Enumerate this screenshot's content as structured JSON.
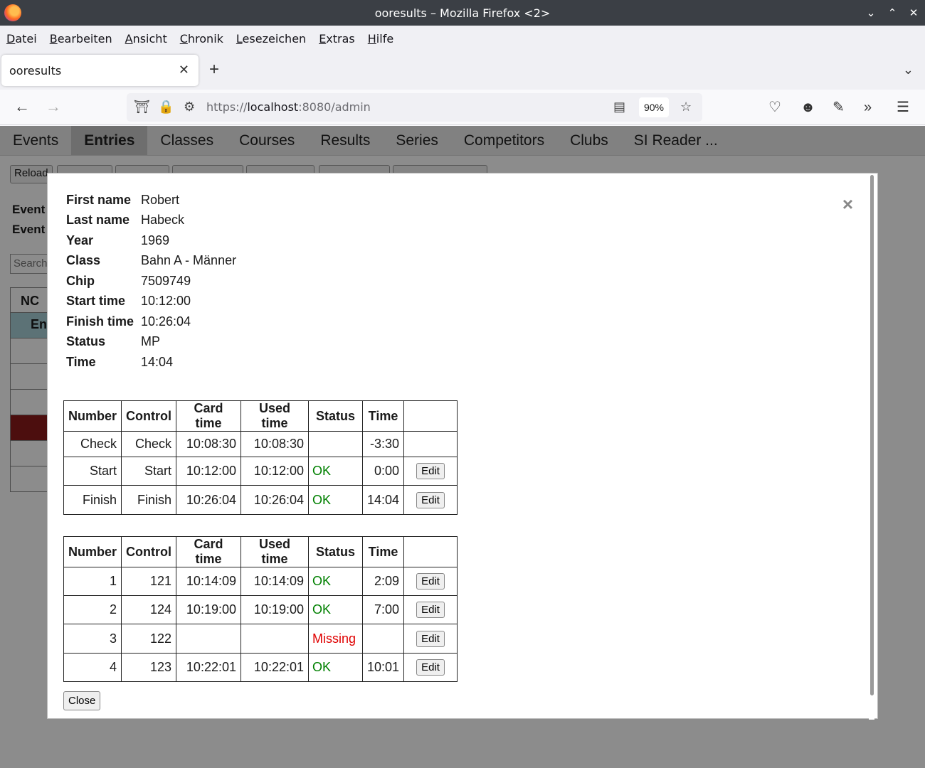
{
  "window": {
    "title": "ooresults – Mozilla Firefox <2>",
    "controls": [
      "⌄",
      "⌃",
      "✕"
    ]
  },
  "menubar": [
    "Datei",
    "Bearbeiten",
    "Ansicht",
    "Chronik",
    "Lesezeichen",
    "Extras",
    "Hilfe"
  ],
  "tab": {
    "label": "ooresults",
    "close": "✕",
    "new": "+",
    "list": "⌄"
  },
  "nav": {
    "url_prefix": "https://",
    "url_host": "localhost",
    "url_rest": ":8080/admin",
    "zoom": "90%"
  },
  "app_nav": {
    "items": [
      "Events",
      "Entries",
      "Classes",
      "Courses",
      "Results",
      "Series",
      "Competitors",
      "Clubs",
      "SI Reader ..."
    ],
    "active": "Entries"
  },
  "background": {
    "toolbar_first": "Reload",
    "event_label_1": "Event",
    "event_label_2": "Event",
    "search_placeholder": "Search",
    "table_header": "NC",
    "table_group": "Ent"
  },
  "details": [
    {
      "label": "First name",
      "value": "Robert"
    },
    {
      "label": "Last name",
      "value": "Habeck"
    },
    {
      "label": "Year",
      "value": "1969"
    },
    {
      "label": "Class",
      "value": "Bahn A - Männer"
    },
    {
      "label": "Chip",
      "value": "7509749"
    },
    {
      "label": "Start time",
      "value": "10:12:00"
    },
    {
      "label": "Finish time",
      "value": "10:26:04"
    },
    {
      "label": "Status",
      "value": "MP"
    },
    {
      "label": "Time",
      "value": "14:04"
    }
  ],
  "table_headers": [
    "Number",
    "Control",
    "Card time",
    "Used time",
    "Status",
    "Time",
    ""
  ],
  "special_punches": [
    {
      "number": "Check",
      "control": "Check",
      "card_time": "10:08:30",
      "used_time": "10:08:30",
      "status": "",
      "time": "-3:30",
      "action": ""
    },
    {
      "number": "Start",
      "control": "Start",
      "card_time": "10:12:00",
      "used_time": "10:12:00",
      "status": "OK",
      "time": "0:00",
      "action": "Edit"
    },
    {
      "number": "Finish",
      "control": "Finish",
      "card_time": "10:26:04",
      "used_time": "10:26:04",
      "status": "OK",
      "time": "14:04",
      "action": "Edit"
    }
  ],
  "control_punches": [
    {
      "number": "1",
      "control": "121",
      "card_time": "10:14:09",
      "used_time": "10:14:09",
      "status": "OK",
      "time": "2:09",
      "action": "Edit"
    },
    {
      "number": "2",
      "control": "124",
      "card_time": "10:19:00",
      "used_time": "10:19:00",
      "status": "OK",
      "time": "7:00",
      "action": "Edit"
    },
    {
      "number": "3",
      "control": "122",
      "card_time": "",
      "used_time": "",
      "status": "Missing",
      "time": "",
      "action": "Edit"
    },
    {
      "number": "4",
      "control": "123",
      "card_time": "10:22:01",
      "used_time": "10:22:01",
      "status": "OK",
      "time": "10:01",
      "action": "Edit"
    }
  ],
  "modal": {
    "close_x": "×",
    "close_button": "Close"
  },
  "colors": {
    "ok": "#008000",
    "missing": "#e00000",
    "titlebar": "#3b3f45"
  }
}
